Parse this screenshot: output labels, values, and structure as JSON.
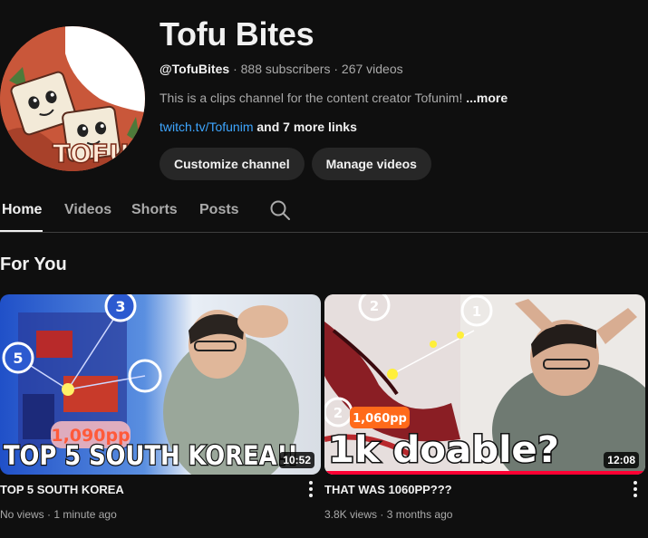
{
  "channel": {
    "name": "Tofu Bites",
    "handle": "@TofuBites",
    "subscribers": "888 subscribers",
    "videos": "267 videos",
    "separator": "·",
    "description": "This is a clips channel for the content creator Tofunim!",
    "description_more": "...more",
    "link": "twitch.tv/Tofunim",
    "more_links": "and 7 more links",
    "avatar_text": "TOFU"
  },
  "actions": {
    "customize": "Customize channel",
    "manage": "Manage videos"
  },
  "tabs": [
    {
      "label": "Home",
      "active": true
    },
    {
      "label": "Videos",
      "active": false
    },
    {
      "label": "Shorts",
      "active": false
    },
    {
      "label": "Posts",
      "active": false
    }
  ],
  "icons": {
    "search": "search-icon",
    "more": "more-vert-icon"
  },
  "section": {
    "title": "For You"
  },
  "videos": [
    {
      "title": "TOP 5 SOUTH KOREA",
      "views": "No views",
      "age": "1 minute ago",
      "duration": "10:52",
      "thumb_text": "TOP 5 SOUTH KOREA!!",
      "thumb_badge": "1,090pp",
      "thumb_numbers": [
        "3",
        "5"
      ],
      "watched_fraction": 0.0
    },
    {
      "title": "THAT WAS 1060PP???",
      "views": "3.8K views",
      "age": "3 months ago",
      "duration": "12:08",
      "thumb_text": "1k doable?",
      "thumb_badge": "1,060pp",
      "thumb_numbers": [
        "2",
        "1",
        "2"
      ],
      "watched_fraction": 1.0
    }
  ],
  "colors": {
    "background": "#0f0f0f",
    "text": "#f1f1f1",
    "secondary_text": "#aaaaaa",
    "link": "#3ea6ff",
    "button_bg": "#272727",
    "progress": "#ff0033",
    "badge_orange": "#ff6a1a"
  }
}
